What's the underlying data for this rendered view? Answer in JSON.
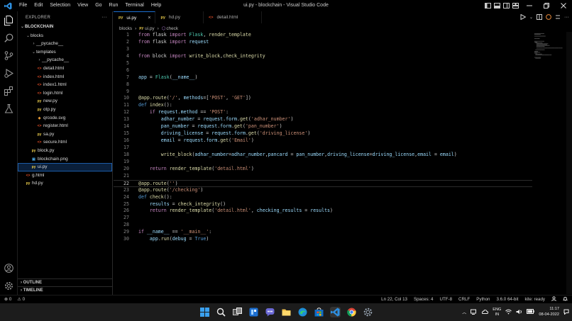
{
  "window": {
    "title": "ui.py - blockchain - Visual Studio Code",
    "menu": [
      "File",
      "Edit",
      "Selection",
      "View",
      "Go",
      "Run",
      "Terminal",
      "Help"
    ]
  },
  "sidebar": {
    "title": "EXPLORER",
    "more": "···",
    "root": "BLOCKCHAIN",
    "items": [
      {
        "label": "blocks",
        "type": "folder",
        "depth": 1,
        "expanded": true
      },
      {
        "label": "__pycache__",
        "type": "folder",
        "depth": 2,
        "expanded": false
      },
      {
        "label": "templates",
        "type": "folder",
        "depth": 2,
        "expanded": true
      },
      {
        "label": "__pycache__",
        "type": "folder",
        "depth": 3,
        "expanded": false
      },
      {
        "label": "detail.html",
        "type": "html",
        "depth": 3
      },
      {
        "label": "index.html",
        "type": "html",
        "depth": 3
      },
      {
        "label": "index1.html",
        "type": "html",
        "depth": 3
      },
      {
        "label": "login.html",
        "type": "html",
        "depth": 3
      },
      {
        "label": "new.py",
        "type": "py",
        "depth": 3
      },
      {
        "label": "otp.py",
        "type": "py",
        "depth": 3
      },
      {
        "label": "qrcode.svg",
        "type": "svg",
        "depth": 3
      },
      {
        "label": "register.html",
        "type": "html",
        "depth": 3
      },
      {
        "label": "sa.py",
        "type": "py",
        "depth": 3
      },
      {
        "label": "secure.html",
        "type": "html",
        "depth": 3
      },
      {
        "label": "block.py",
        "type": "py",
        "depth": 2
      },
      {
        "label": "blockchain.png",
        "type": "png",
        "depth": 2
      },
      {
        "label": "ui.py",
        "type": "py",
        "depth": 2,
        "selected": true
      },
      {
        "label": "g.html",
        "type": "html",
        "depth": 1
      },
      {
        "label": "hd.py",
        "type": "py",
        "depth": 1
      }
    ],
    "outline": "OUTLINE",
    "timeline": "TIMELINE"
  },
  "tabs": [
    {
      "label": "ui.py",
      "type": "py",
      "active": true,
      "close": "×"
    },
    {
      "label": "hd.py",
      "type": "py",
      "active": false
    },
    {
      "label": "detail.html",
      "type": "html",
      "active": false
    }
  ],
  "breadcrumb": {
    "folder": "blocks",
    "sep": "›",
    "file": "ui.py",
    "symbol": "check"
  },
  "code": [
    [
      [
        "kw2",
        "from "
      ],
      [
        "plain",
        "flask "
      ],
      [
        "kw2",
        "import "
      ],
      [
        "cls",
        "Flask"
      ],
      [
        "plain",
        ", "
      ],
      [
        "fn",
        "render_template"
      ]
    ],
    [
      [
        "kw2",
        "from "
      ],
      [
        "plain",
        "flask "
      ],
      [
        "kw2",
        "import "
      ],
      [
        "var",
        "request"
      ]
    ],
    [],
    [
      [
        "kw2",
        "from "
      ],
      [
        "plain",
        "block "
      ],
      [
        "kw2",
        "import "
      ],
      [
        "fn",
        "write_block"
      ],
      [
        "plain",
        ","
      ],
      [
        "fn",
        "check_integrity"
      ]
    ],
    [],
    [],
    [
      [
        "var",
        "app "
      ],
      [
        "plain",
        "= "
      ],
      [
        "cls",
        "Flask"
      ],
      [
        "plain",
        "("
      ],
      [
        "var",
        "__name__"
      ],
      [
        "plain",
        ")"
      ]
    ],
    [],
    [],
    [
      [
        "fn",
        "@app.route"
      ],
      [
        "plain",
        "("
      ],
      [
        "str",
        "'/'"
      ],
      [
        "plain",
        ", "
      ],
      [
        "var",
        "methods"
      ],
      [
        "plain",
        "=["
      ],
      [
        "str",
        "'POST'"
      ],
      [
        "plain",
        ", "
      ],
      [
        "str",
        "'GET'"
      ],
      [
        "plain",
        "])"
      ]
    ],
    [
      [
        "kw",
        "def "
      ],
      [
        "fn",
        "index"
      ],
      [
        "plain",
        "():"
      ]
    ],
    [
      [
        "plain",
        "    "
      ],
      [
        "kw2",
        "if "
      ],
      [
        "var",
        "request"
      ],
      [
        "plain",
        "."
      ],
      [
        "var",
        "method "
      ],
      [
        "plain",
        "== "
      ],
      [
        "str",
        "'POST'"
      ],
      [
        "plain",
        ":"
      ]
    ],
    [
      [
        "plain",
        "        "
      ],
      [
        "var",
        "adhar_number "
      ],
      [
        "plain",
        "= "
      ],
      [
        "var",
        "request"
      ],
      [
        "plain",
        "."
      ],
      [
        "var",
        "form"
      ],
      [
        "plain",
        "."
      ],
      [
        "fn",
        "get"
      ],
      [
        "plain",
        "("
      ],
      [
        "str",
        "'adhar_number'"
      ],
      [
        "plain",
        ")"
      ]
    ],
    [
      [
        "plain",
        "        "
      ],
      [
        "var",
        "pan_number "
      ],
      [
        "plain",
        "= "
      ],
      [
        "var",
        "request"
      ],
      [
        "plain",
        "."
      ],
      [
        "var",
        "form"
      ],
      [
        "plain",
        "."
      ],
      [
        "fn",
        "get"
      ],
      [
        "plain",
        "("
      ],
      [
        "str",
        "'pan_number'"
      ],
      [
        "plain",
        ")"
      ]
    ],
    [
      [
        "plain",
        "        "
      ],
      [
        "var",
        "driving_license "
      ],
      [
        "plain",
        "= "
      ],
      [
        "var",
        "request"
      ],
      [
        "plain",
        "."
      ],
      [
        "var",
        "form"
      ],
      [
        "plain",
        "."
      ],
      [
        "fn",
        "get"
      ],
      [
        "plain",
        "("
      ],
      [
        "str",
        "'driving_license'"
      ],
      [
        "plain",
        ")"
      ]
    ],
    [
      [
        "plain",
        "        "
      ],
      [
        "var",
        "email "
      ],
      [
        "plain",
        "= "
      ],
      [
        "var",
        "request"
      ],
      [
        "plain",
        "."
      ],
      [
        "var",
        "form"
      ],
      [
        "plain",
        "."
      ],
      [
        "fn",
        "get"
      ],
      [
        "plain",
        "("
      ],
      [
        "str",
        "'Email'"
      ],
      [
        "plain",
        ")"
      ]
    ],
    [],
    [
      [
        "plain",
        "        "
      ],
      [
        "fn",
        "write_block"
      ],
      [
        "plain",
        "("
      ],
      [
        "var",
        "adhar_number"
      ],
      [
        "plain",
        "="
      ],
      [
        "var",
        "adhar_number"
      ],
      [
        "plain",
        ","
      ],
      [
        "var",
        "pancard "
      ],
      [
        "plain",
        "= "
      ],
      [
        "var",
        "pan_number"
      ],
      [
        "plain",
        ","
      ],
      [
        "var",
        "driving_license"
      ],
      [
        "plain",
        "="
      ],
      [
        "var",
        "driving_license"
      ],
      [
        "plain",
        ","
      ],
      [
        "var",
        "email "
      ],
      [
        "plain",
        "= "
      ],
      [
        "var",
        "email"
      ],
      [
        "plain",
        ")"
      ]
    ],
    [],
    [
      [
        "plain",
        "    "
      ],
      [
        "kw2",
        "return "
      ],
      [
        "fn",
        "render_template"
      ],
      [
        "plain",
        "("
      ],
      [
        "str",
        "'detail.html'"
      ],
      [
        "plain",
        ")"
      ]
    ],
    [],
    [
      [
        "fn",
        "@app.route"
      ],
      [
        "plain",
        "("
      ],
      [
        "str",
        "''"
      ],
      [
        "plain",
        ")"
      ]
    ],
    [
      [
        "fn",
        "@app.route"
      ],
      [
        "plain",
        "("
      ],
      [
        "str",
        "'/checking'"
      ],
      [
        "plain",
        ")"
      ]
    ],
    [
      [
        "kw",
        "def "
      ],
      [
        "fn",
        "check"
      ],
      [
        "plain",
        "():"
      ]
    ],
    [
      [
        "plain",
        "    "
      ],
      [
        "var",
        "results "
      ],
      [
        "plain",
        "= "
      ],
      [
        "fn",
        "check_integrity"
      ],
      [
        "plain",
        "()"
      ]
    ],
    [
      [
        "plain",
        "    "
      ],
      [
        "kw2",
        "return "
      ],
      [
        "fn",
        "render_template"
      ],
      [
        "plain",
        "("
      ],
      [
        "str",
        "'detail.html'"
      ],
      [
        "plain",
        ", "
      ],
      [
        "var",
        "checking_results "
      ],
      [
        "plain",
        "= "
      ],
      [
        "var",
        "results"
      ],
      [
        "plain",
        ")"
      ]
    ],
    [],
    [],
    [
      [
        "kw2",
        "if "
      ],
      [
        "var",
        "__name__ "
      ],
      [
        "plain",
        "== "
      ],
      [
        "str",
        "'__main__'"
      ],
      [
        "plain",
        ":"
      ]
    ],
    [
      [
        "plain",
        "    "
      ],
      [
        "var",
        "app"
      ],
      [
        "plain",
        "."
      ],
      [
        "fn",
        "run"
      ],
      [
        "plain",
        "("
      ],
      [
        "var",
        "debug "
      ],
      [
        "plain",
        "= "
      ],
      [
        "kw",
        "True"
      ],
      [
        "plain",
        ")"
      ]
    ]
  ],
  "current_line": 22,
  "statusbar": {
    "errors": "⊗ 0",
    "warnings": "⚠ 0",
    "position": "Ln 22, Col 13",
    "spaces": "Spaces: 4",
    "encoding": "UTF-8",
    "eol": "CRLF",
    "language": "Python",
    "interpreter": "3.6.0 64-bit",
    "kite": "kite: ready"
  },
  "taskbar": {
    "lang_top": "ENG",
    "lang_bottom": "IN",
    "time": "11:17",
    "date": "08-04-2022"
  },
  "colors": {
    "accent": "#1c6fd1",
    "py": "#e6c84a",
    "html": "#e44d26",
    "svg": "#f2a33a",
    "png": "#4aa3df"
  }
}
